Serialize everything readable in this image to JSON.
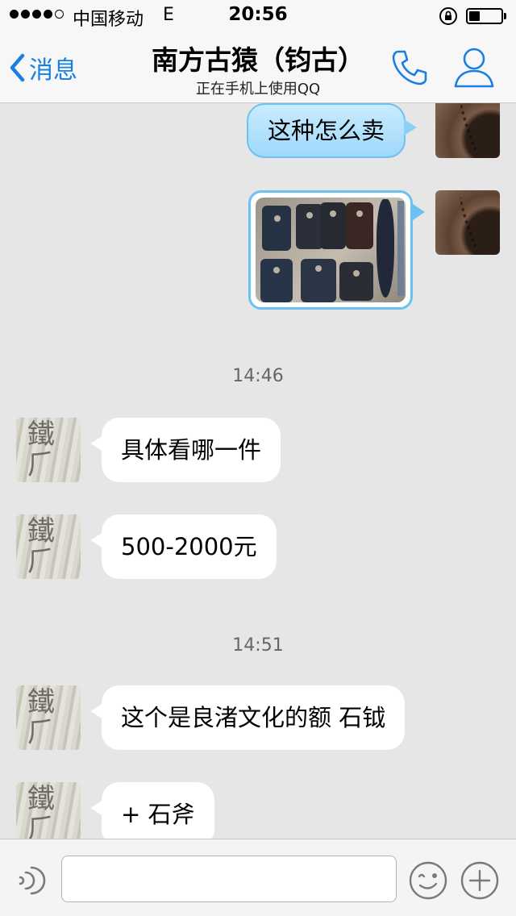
{
  "status_bar": {
    "carrier": "中国移动",
    "network": "E",
    "time": "20:56",
    "battery_level": 0.35,
    "signal_bars_filled": 4,
    "signal_bars_total": 5,
    "icons": [
      "signal-icon",
      "rotation-lock-icon",
      "battery-icon"
    ]
  },
  "nav": {
    "back_label": "消息",
    "title": "南方古猿（钧古）",
    "subtitle": "正在手机上使用QQ",
    "icons": [
      "chevron-left-icon",
      "phone-icon",
      "person-icon"
    ]
  },
  "colors": {
    "accent": "#1a7fe0",
    "chat_bg": "#e6e6e6",
    "sent_bubble": "#b5e2fb",
    "received_bubble": "#ffffff"
  },
  "messages": [
    {
      "side": "right",
      "type": "text",
      "text": "这种怎么卖"
    },
    {
      "side": "right",
      "type": "image",
      "alt": "stone-artifacts-photo"
    },
    {
      "type": "timestamp",
      "text": "14:46"
    },
    {
      "side": "left",
      "type": "text",
      "text": "具体看哪一件"
    },
    {
      "side": "left",
      "type": "text",
      "text": "500-2000元"
    },
    {
      "type": "timestamp",
      "text": "14:51"
    },
    {
      "side": "left",
      "type": "text",
      "text": "这个是良渚文化的额 石钺"
    },
    {
      "side": "left",
      "type": "text",
      "text": "+ 石斧"
    }
  ],
  "toolbar": {
    "input_value": "",
    "icons": [
      "voice-icon",
      "emoji-icon",
      "plus-icon"
    ]
  }
}
